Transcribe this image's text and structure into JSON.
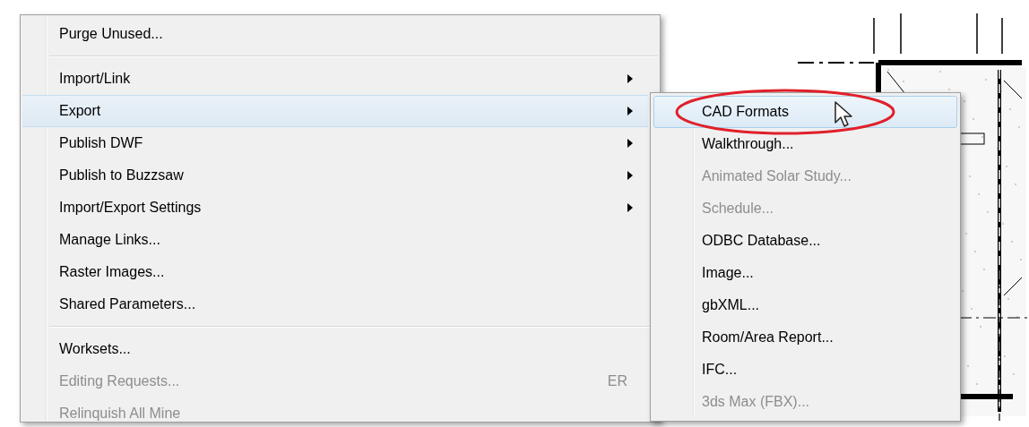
{
  "menu": {
    "items": [
      {
        "kind": "item",
        "label": "Purge Unused...",
        "disabled": false,
        "selected": false,
        "has_submenu": false
      },
      {
        "kind": "separator"
      },
      {
        "kind": "item",
        "label": "Import/Link",
        "disabled": false,
        "selected": false,
        "has_submenu": true
      },
      {
        "kind": "item",
        "label": "Export",
        "disabled": false,
        "selected": true,
        "has_submenu": true
      },
      {
        "kind": "item",
        "label": "Publish DWF",
        "disabled": false,
        "selected": false,
        "has_submenu": true
      },
      {
        "kind": "item",
        "label": "Publish to Buzzsaw",
        "disabled": false,
        "selected": false,
        "has_submenu": true
      },
      {
        "kind": "item",
        "label": "Import/Export Settings",
        "disabled": false,
        "selected": false,
        "has_submenu": true
      },
      {
        "kind": "item",
        "label": "Manage Links...",
        "disabled": false,
        "selected": false,
        "has_submenu": false
      },
      {
        "kind": "item",
        "label": "Raster Images...",
        "disabled": false,
        "selected": false,
        "has_submenu": false
      },
      {
        "kind": "item",
        "label": "Shared Parameters...",
        "disabled": false,
        "selected": false,
        "has_submenu": false
      },
      {
        "kind": "separator"
      },
      {
        "kind": "item",
        "label": "Worksets...",
        "disabled": false,
        "selected": false,
        "has_submenu": false
      },
      {
        "kind": "item",
        "label": "Editing Requests...",
        "disabled": true,
        "selected": false,
        "has_submenu": false,
        "shortcut": "ER"
      },
      {
        "kind": "item",
        "label": "Relinquish All Mine",
        "disabled": true,
        "selected": false,
        "has_submenu": false
      }
    ]
  },
  "submenu": {
    "items": [
      {
        "label": "CAD Formats",
        "disabled": false,
        "selected": true
      },
      {
        "label": "Walkthrough...",
        "disabled": false,
        "selected": false
      },
      {
        "label": "Animated Solar Study...",
        "disabled": true,
        "selected": false
      },
      {
        "label": "Schedule...",
        "disabled": true,
        "selected": false
      },
      {
        "label": "ODBC Database...",
        "disabled": false,
        "selected": false
      },
      {
        "label": "Image...",
        "disabled": false,
        "selected": false
      },
      {
        "label": "gbXML...",
        "disabled": false,
        "selected": false
      },
      {
        "label": "Room/Area Report...",
        "disabled": false,
        "selected": false
      },
      {
        "label": "IFC...",
        "disabled": false,
        "selected": false
      },
      {
        "label": "3ds Max (FBX)...",
        "disabled": true,
        "selected": false
      }
    ]
  }
}
